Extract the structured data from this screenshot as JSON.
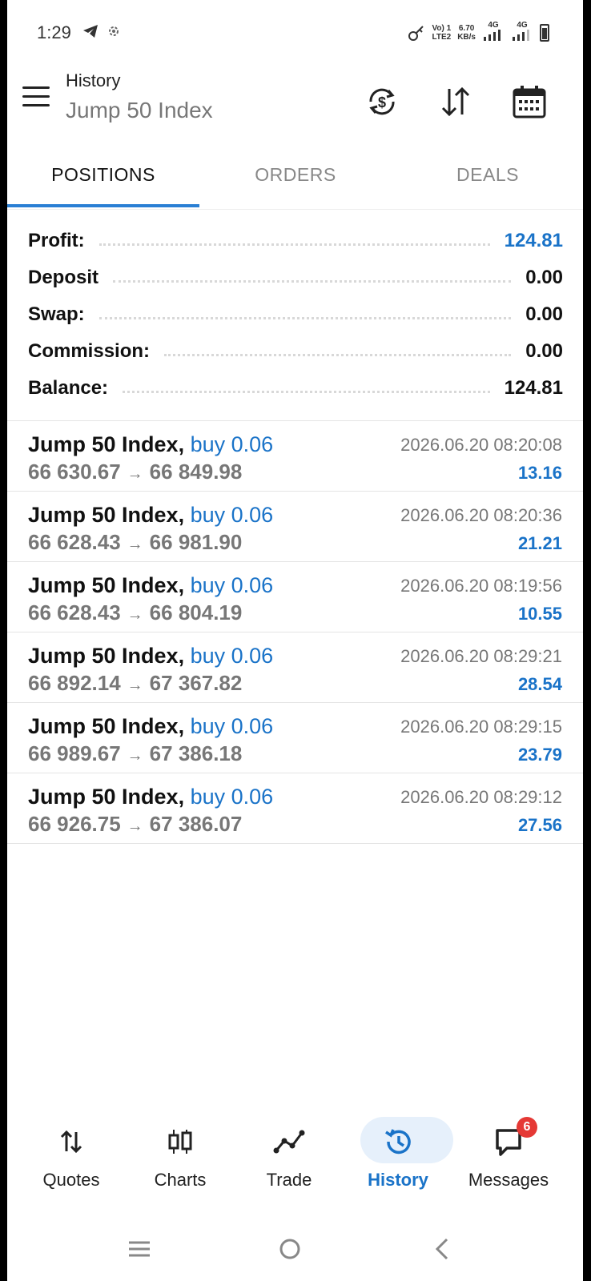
{
  "status_bar": {
    "time": "1:29",
    "network_top": "Vo) 1",
    "network_bottom": "LTE2",
    "speed_value": "6.70",
    "speed_unit": "KB/s",
    "sim1": "4G",
    "sim2": "4G"
  },
  "header": {
    "subtitle": "History",
    "title": "Jump 50 Index"
  },
  "tabs": [
    {
      "label": "POSITIONS",
      "active": true
    },
    {
      "label": "ORDERS",
      "active": false
    },
    {
      "label": "DEALS",
      "active": false
    }
  ],
  "summary": {
    "profit_label": "Profit:",
    "profit_value": "124.81",
    "deposit_label": "Deposit",
    "deposit_value": "0.00",
    "swap_label": "Swap:",
    "swap_value": "0.00",
    "commission_label": "Commission:",
    "commission_value": "0.00",
    "balance_label": "Balance:",
    "balance_value": "124.81"
  },
  "deals": [
    {
      "symbol": "Jump 50 Index,",
      "side": "buy 0.06",
      "open": "66 630.67",
      "close": "66 849.98",
      "time": "2026.06.20 08:20:08",
      "profit": "13.16"
    },
    {
      "symbol": "Jump 50 Index,",
      "side": "buy 0.06",
      "open": "66 628.43",
      "close": "66 981.90",
      "time": "2026.06.20 08:20:36",
      "profit": "21.21"
    },
    {
      "symbol": "Jump 50 Index,",
      "side": "buy 0.06",
      "open": "66 628.43",
      "close": "66 804.19",
      "time": "2026.06.20 08:19:56",
      "profit": "10.55"
    },
    {
      "symbol": "Jump 50 Index,",
      "side": "buy 0.06",
      "open": "66 892.14",
      "close": "67 367.82",
      "time": "2026.06.20 08:29:21",
      "profit": "28.54"
    },
    {
      "symbol": "Jump 50 Index,",
      "side": "buy 0.06",
      "open": "66 989.67",
      "close": "67 386.18",
      "time": "2026.06.20 08:29:15",
      "profit": "23.79"
    },
    {
      "symbol": "Jump 50 Index,",
      "side": "buy 0.06",
      "open": "66 926.75",
      "close": "67 386.07",
      "time": "2026.06.20 08:29:12",
      "profit": "27.56"
    }
  ],
  "arrow_glyph": "→",
  "bottom_nav": {
    "quotes": "Quotes",
    "charts": "Charts",
    "trade": "Trade",
    "history": "History",
    "messages": "Messages",
    "messages_badge": "6"
  },
  "colors": {
    "accent": "#1a73c8",
    "active_pill": "#e6f0fb",
    "badge": "#e53935"
  }
}
